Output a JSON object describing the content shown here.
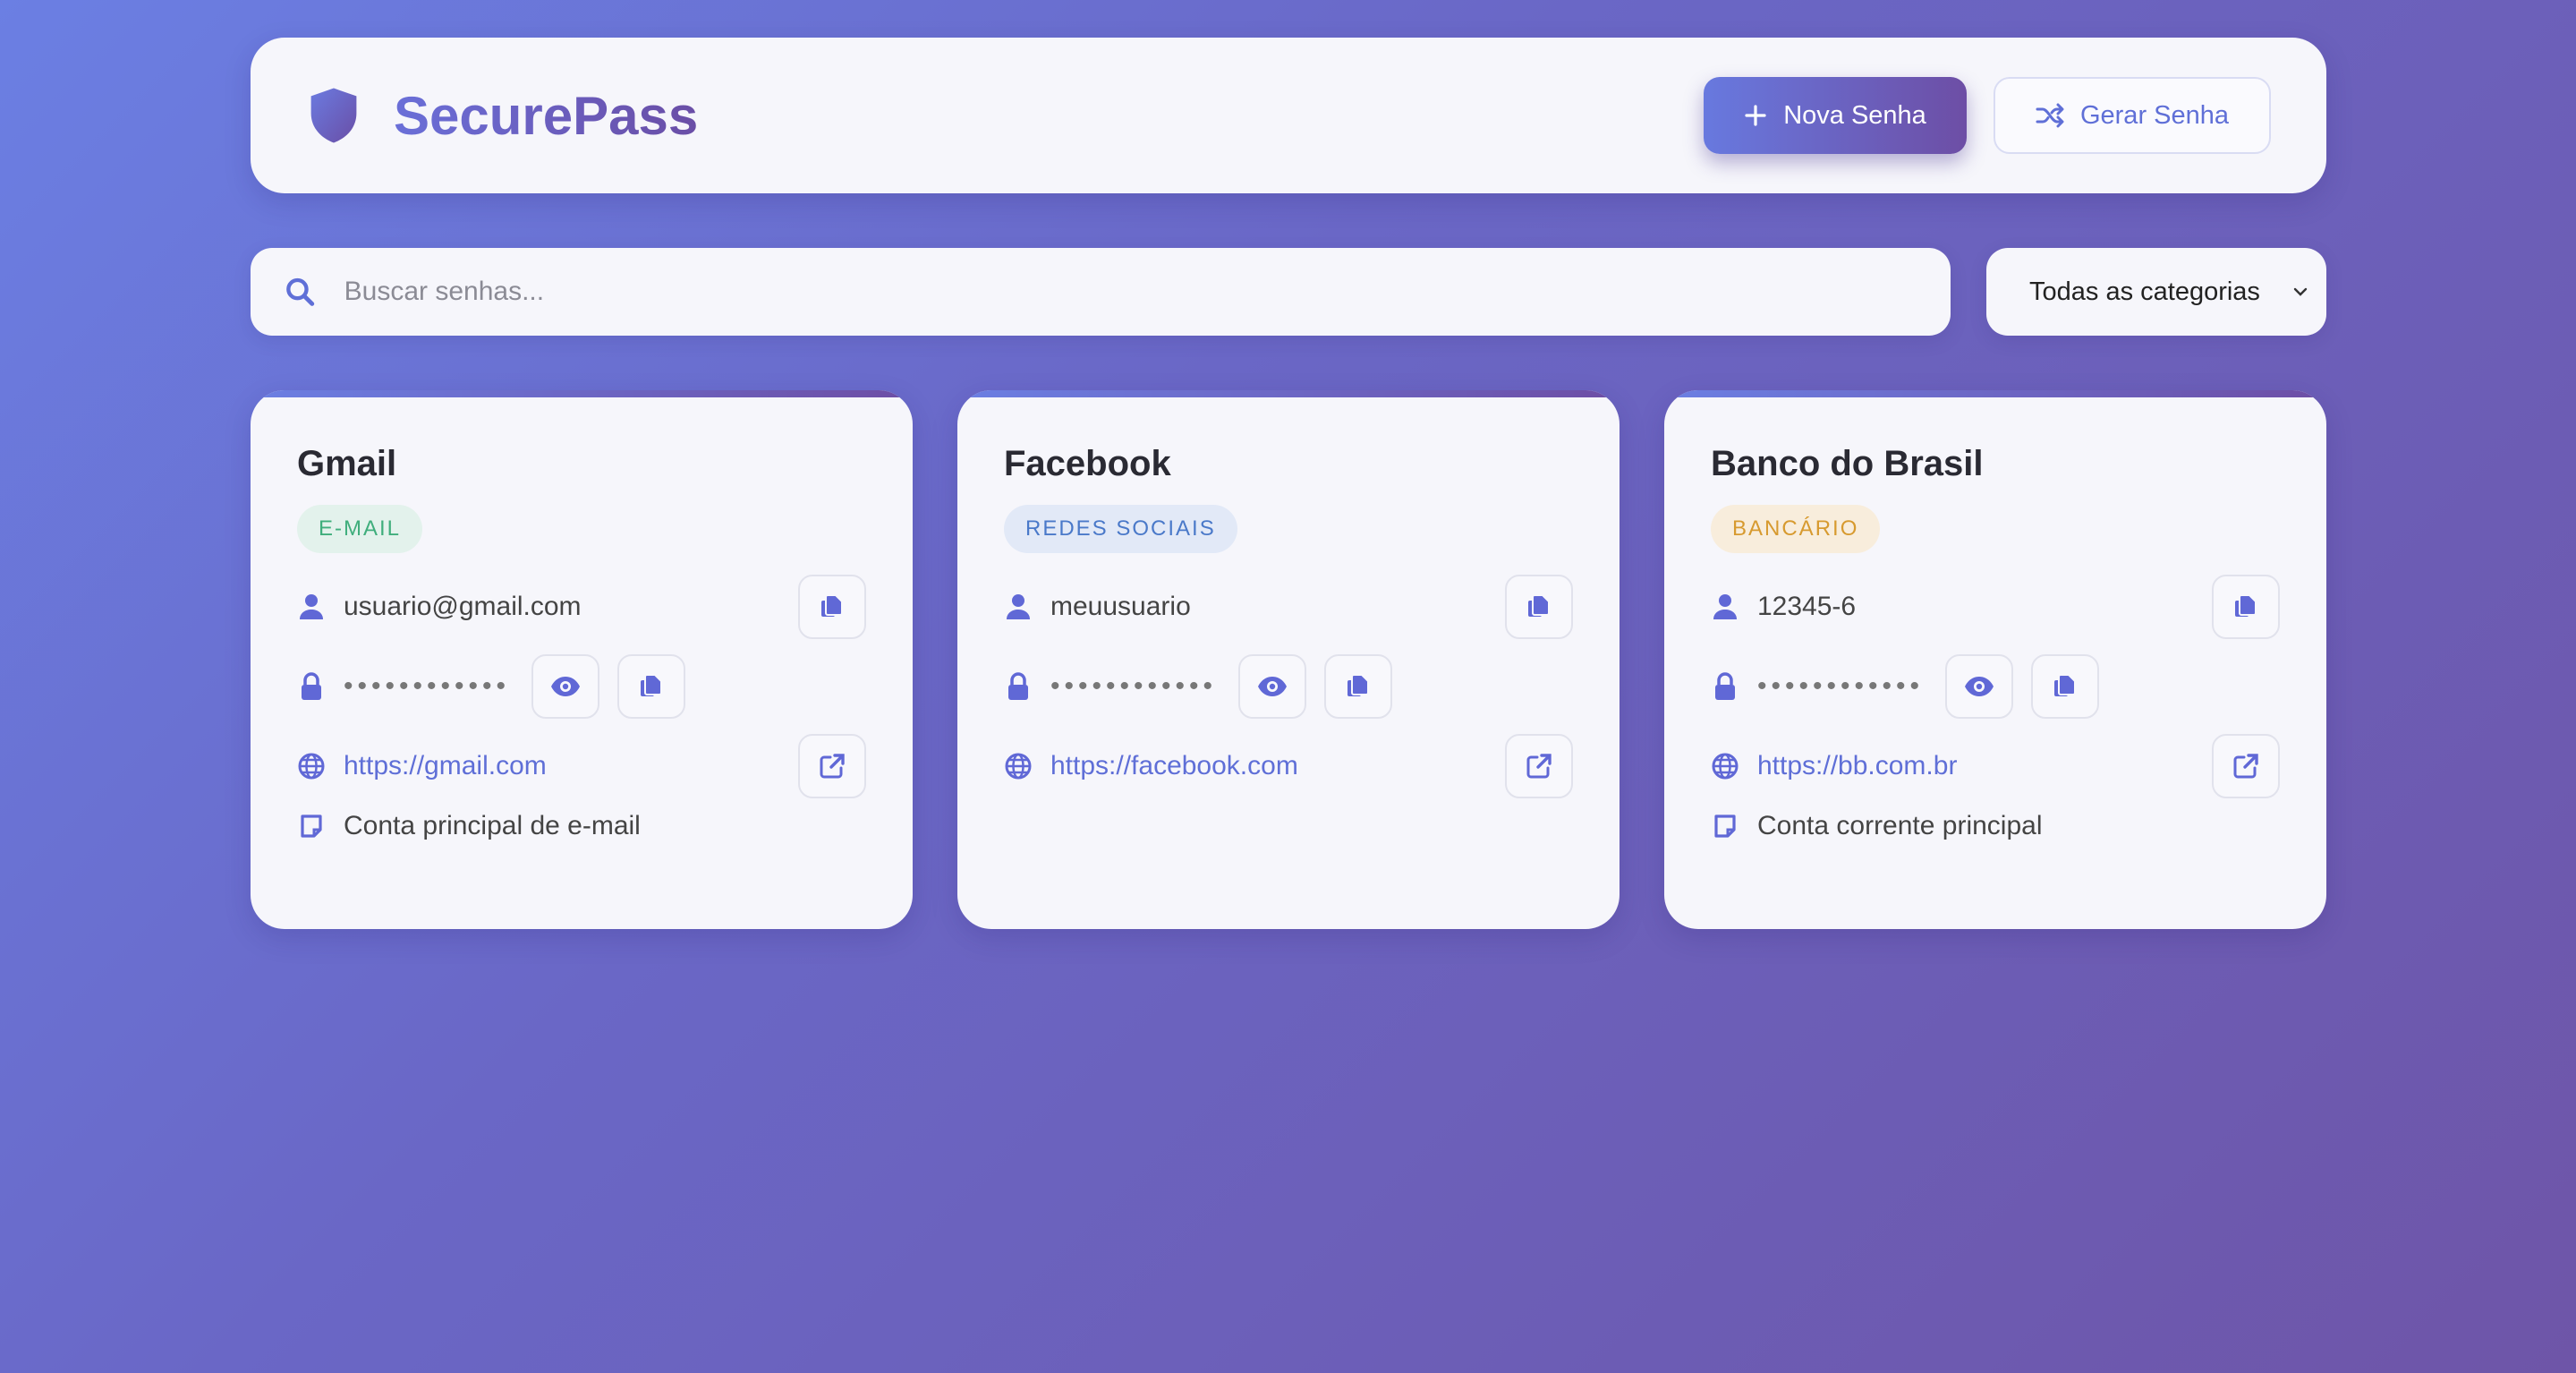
{
  "header": {
    "brand": "SecurePass",
    "new_button": "Nova Senha",
    "generate_button": "Gerar Senha"
  },
  "search": {
    "placeholder": "Buscar senhas...",
    "category": "Todas as categorias"
  },
  "cards": [
    {
      "title": "Gmail",
      "category": "E-MAIL",
      "username": "usuario@gmail.com",
      "password": "••••••••••••",
      "url": "https://gmail.com",
      "note": "Conta principal de e-mail"
    },
    {
      "title": "Facebook",
      "category": "REDES SOCIAIS",
      "username": "meuusuario",
      "password": "••••••••••••",
      "url": "https://facebook.com",
      "note": ""
    },
    {
      "title": "Banco do Brasil",
      "category": "BANCÁRIO",
      "username": "12345-6",
      "password": "••••••••••••",
      "url": "https://bb.com.br",
      "note": "Conta corrente principal"
    }
  ],
  "colors": {
    "accent": "#6068d6",
    "badge_email_bg": "#e3f2ec",
    "badge_email_fg": "#3fae7c",
    "badge_social_bg": "#e2e9f7",
    "badge_social_fg": "#4a79c9",
    "badge_bank_bg": "#f8eddc",
    "badge_bank_fg": "#d79a2f"
  },
  "icons": [
    "shield-icon",
    "plus-icon",
    "shuffle-icon",
    "search-icon",
    "chevron-down-icon",
    "user-icon",
    "lock-icon",
    "globe-icon",
    "note-icon",
    "copy-icon",
    "eye-icon",
    "external-link-icon"
  ]
}
